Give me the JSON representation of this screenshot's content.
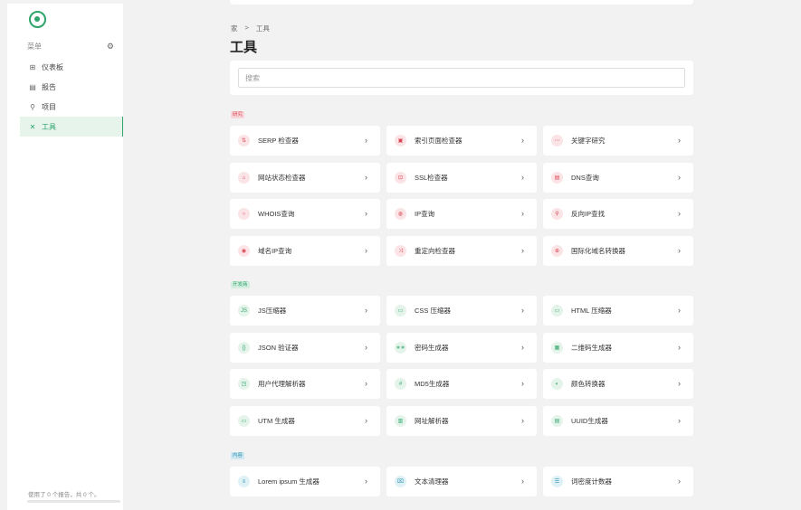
{
  "sidebar": {
    "menu_title": "菜单",
    "items": [
      {
        "label": "仪表板",
        "icon": "dashboard-icon",
        "glyph": "⊞",
        "active": false
      },
      {
        "label": "报告",
        "icon": "report-icon",
        "glyph": "▤",
        "active": false
      },
      {
        "label": "项目",
        "icon": "project-icon",
        "glyph": "⚲",
        "active": false
      },
      {
        "label": "工具",
        "icon": "tools-icon",
        "glyph": "✕",
        "active": true
      }
    ],
    "usage_text": "使用了 0 个报告，共 0 个。",
    "usage_fraction": 0
  },
  "breadcrumb": {
    "home": "家",
    "separator": ">",
    "current": "工具"
  },
  "page_title": "工具",
  "search": {
    "placeholder": "搜索",
    "value": ""
  },
  "sections": [
    {
      "tag": "研究",
      "tag_color": "#d94452",
      "tag_bg": "#f8d7da",
      "theme": "red",
      "tools": [
        {
          "label": "SERP 检查器",
          "icon": "serp-icon",
          "glyph": "⇅"
        },
        {
          "label": "索引页面检查器",
          "icon": "index-page-icon",
          "glyph": "▣"
        },
        {
          "label": "关键字研究",
          "icon": "keyword-icon",
          "glyph": "⋯"
        },
        {
          "label": "网站状态检查器",
          "icon": "site-status-icon",
          "glyph": "⌂"
        },
        {
          "label": "SSL检查器",
          "icon": "lock-icon",
          "glyph": "⊡"
        },
        {
          "label": "DNS查询",
          "icon": "dns-icon",
          "glyph": "▤"
        },
        {
          "label": "WHOIS查询",
          "icon": "whois-icon",
          "glyph": "○"
        },
        {
          "label": "IP查询",
          "icon": "ip-icon",
          "glyph": "◍"
        },
        {
          "label": "反向IP查找",
          "icon": "reverse-ip-icon",
          "glyph": "⚲"
        },
        {
          "label": "域名IP查询",
          "icon": "domain-ip-icon",
          "glyph": "◉"
        },
        {
          "label": "重定向检查器",
          "icon": "redirect-icon",
          "glyph": "⤨"
        },
        {
          "label": "国际化域名转换器",
          "icon": "globe-icon",
          "glyph": "⊕"
        }
      ]
    },
    {
      "tag": "开发商",
      "tag_color": "#2ea36a",
      "tag_bg": "#d4efe0",
      "theme": "green",
      "tools": [
        {
          "label": "JS压缩器",
          "icon": "js-icon",
          "glyph": "JS"
        },
        {
          "label": "CSS 压缩器",
          "icon": "css-icon",
          "glyph": "▭"
        },
        {
          "label": "HTML 压缩器",
          "icon": "html-icon",
          "glyph": "▭"
        },
        {
          "label": "JSON 验证器",
          "icon": "json-icon",
          "glyph": "{}"
        },
        {
          "label": "密码生成器",
          "icon": "password-icon",
          "glyph": "∗∗"
        },
        {
          "label": "二维码生成器",
          "icon": "qr-code-icon",
          "glyph": "▦"
        },
        {
          "label": "用户代理解析器",
          "icon": "user-agent-icon",
          "glyph": "◳"
        },
        {
          "label": "MD5生成器",
          "icon": "hash-icon",
          "glyph": "#"
        },
        {
          "label": "颜色转换器",
          "icon": "color-icon",
          "glyph": "◐"
        },
        {
          "label": "UTM 生成器",
          "icon": "utm-icon",
          "glyph": "▭"
        },
        {
          "label": "网址解析器",
          "icon": "url-parser-icon",
          "glyph": "▥"
        },
        {
          "label": "UUID生成器",
          "icon": "uuid-icon",
          "glyph": "▤"
        }
      ]
    },
    {
      "tag": "内容",
      "tag_color": "#2b92b0",
      "tag_bg": "#cfe8f1",
      "theme": "teal",
      "tools": [
        {
          "label": "Lorem ipsum 生成器",
          "icon": "lorem-icon",
          "glyph": "≡"
        },
        {
          "label": "文本清理器",
          "icon": "text-cleaner-icon",
          "glyph": "⌧"
        },
        {
          "label": "词密度计数器",
          "icon": "word-density-icon",
          "glyph": "☰"
        }
      ]
    }
  ]
}
